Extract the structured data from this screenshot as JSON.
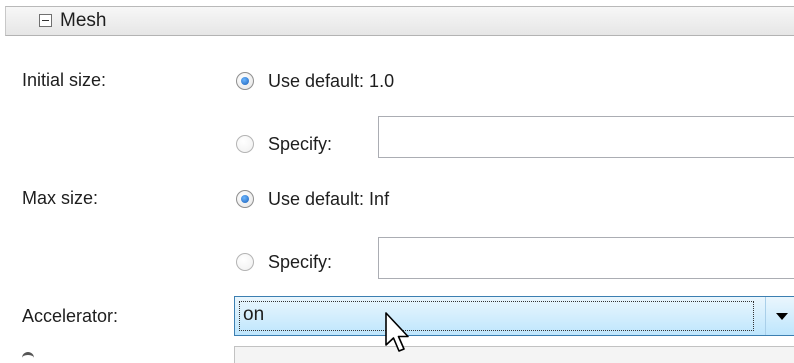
{
  "section": {
    "title": "Mesh",
    "toggle_icon": "collapse-minus-icon"
  },
  "initial_size": {
    "label": "Initial size:",
    "default_option": {
      "label": "Use default: 1.0",
      "selected": true
    },
    "specify_option": {
      "label": "Specify:",
      "selected": false
    },
    "specify_value": ""
  },
  "max_size": {
    "label": "Max size:",
    "default_option": {
      "label": "Use default: Inf",
      "selected": true
    },
    "specify_option": {
      "label": "Specify:",
      "selected": false
    },
    "specify_value": ""
  },
  "accelerator": {
    "label": "Accelerator:",
    "value": "on",
    "arrow_icon": "dropdown-arrow-icon"
  },
  "cursor": {
    "icon": "mouse-pointer-icon"
  },
  "colors": {
    "dropdown_highlight": "#bee6fd",
    "dropdown_border": "#3c7fb1",
    "radio_selected": "#1a5fb8",
    "header_background": "#e6e6e6"
  }
}
